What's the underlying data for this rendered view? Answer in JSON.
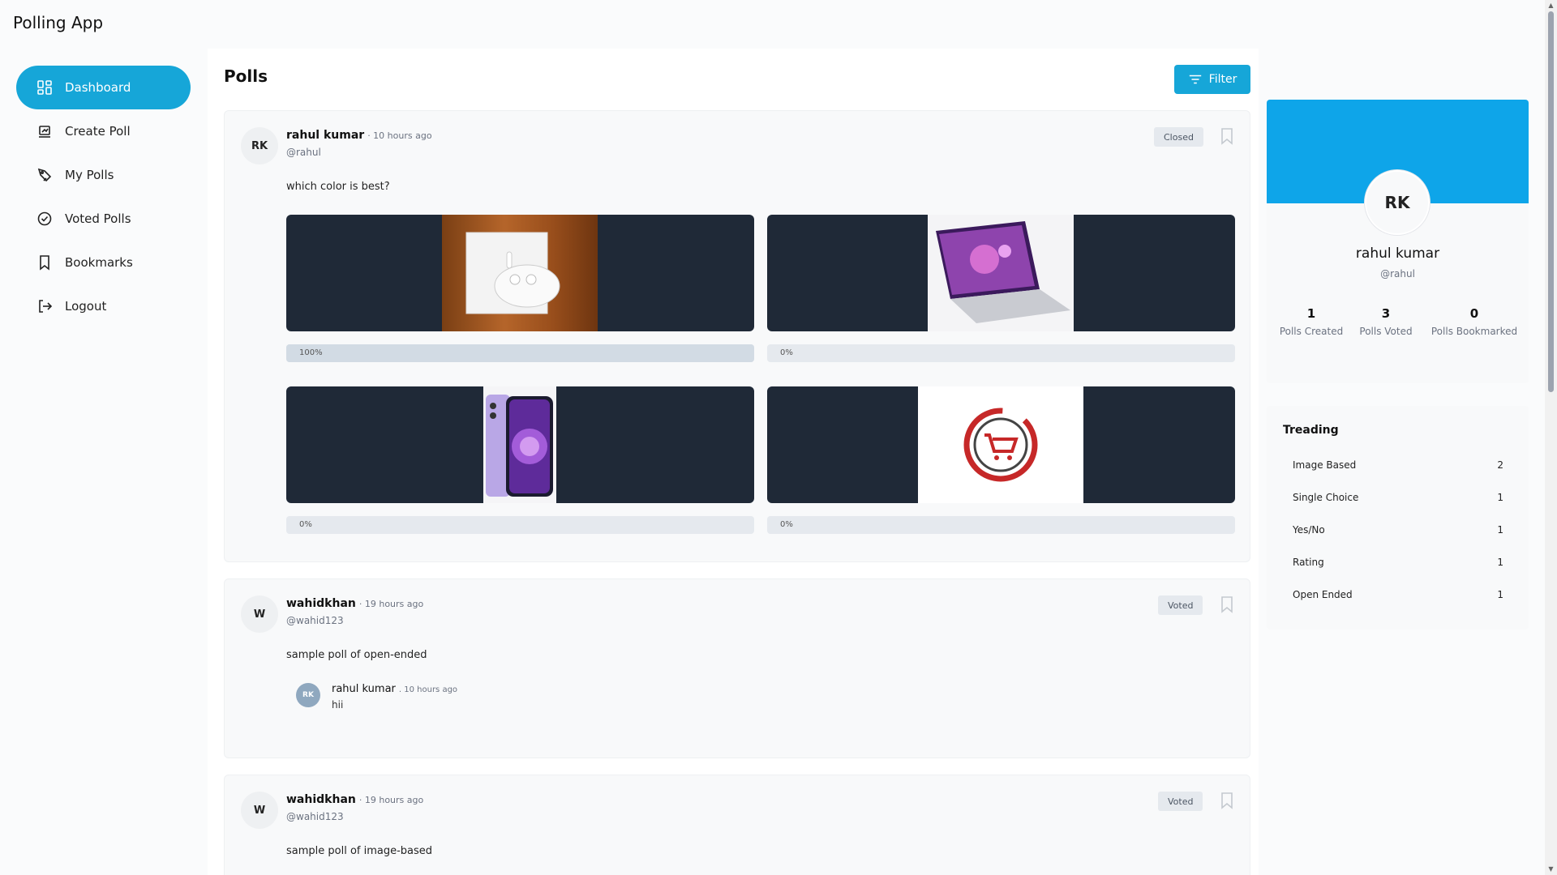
{
  "app": {
    "title": "Polling App"
  },
  "sidebar": {
    "items": [
      {
        "label": "Dashboard",
        "icon": "dashboard-icon",
        "active": true
      },
      {
        "label": "Create Poll",
        "icon": "create-poll-icon"
      },
      {
        "label": "My Polls",
        "icon": "my-polls-icon"
      },
      {
        "label": "Voted Polls",
        "icon": "check-circle-icon"
      },
      {
        "label": "Bookmarks",
        "icon": "bookmark-icon"
      },
      {
        "label": "Logout",
        "icon": "logout-icon"
      }
    ]
  },
  "main": {
    "title": "Polls",
    "filter_label": "Filter",
    "polls": [
      {
        "avatar": "RK",
        "author": "rahul kumar",
        "time": "· 10 hours ago",
        "handle": "@rahul",
        "status": "Closed",
        "question": "which color is best?",
        "options": [
          {
            "image": "airpods",
            "percent": "100%",
            "fraction": 1.0
          },
          {
            "image": "laptop",
            "percent": "0%",
            "fraction": 0.0
          },
          {
            "image": "iphone",
            "percent": "0%",
            "fraction": 0.0
          },
          {
            "image": "shopping-cart-logo",
            "percent": "0%",
            "fraction": 0.0
          }
        ]
      },
      {
        "avatar": "W",
        "author": "wahidkhan",
        "time": "· 19 hours ago",
        "handle": "@wahid123",
        "status": "Voted",
        "question": "sample poll of open-ended",
        "comment": {
          "avatar": "RK",
          "author": "rahul kumar",
          "time": ". 10 hours ago",
          "text": "hii"
        }
      },
      {
        "avatar": "W",
        "author": "wahidkhan",
        "time": "· 19 hours ago",
        "handle": "@wahid123",
        "status": "Voted",
        "question": "sample poll of image-based"
      }
    ]
  },
  "profile": {
    "avatar": "RK",
    "name": "rahul kumar",
    "handle": "@rahul",
    "stats": [
      {
        "value": "1",
        "label": "Polls Created"
      },
      {
        "value": "3",
        "label": "Polls Voted"
      },
      {
        "value": "0",
        "label": "Polls Bookmarked"
      }
    ],
    "banner_color": "#0ea5e9"
  },
  "trending": {
    "title": "Treading",
    "items": [
      {
        "label": "Image Based",
        "count": "2"
      },
      {
        "label": "Single Choice",
        "count": "1"
      },
      {
        "label": "Yes/No",
        "count": "1"
      },
      {
        "label": "Rating",
        "count": "1"
      },
      {
        "label": "Open Ended",
        "count": "1"
      }
    ]
  },
  "colors": {
    "accent": "#16a6d8"
  }
}
